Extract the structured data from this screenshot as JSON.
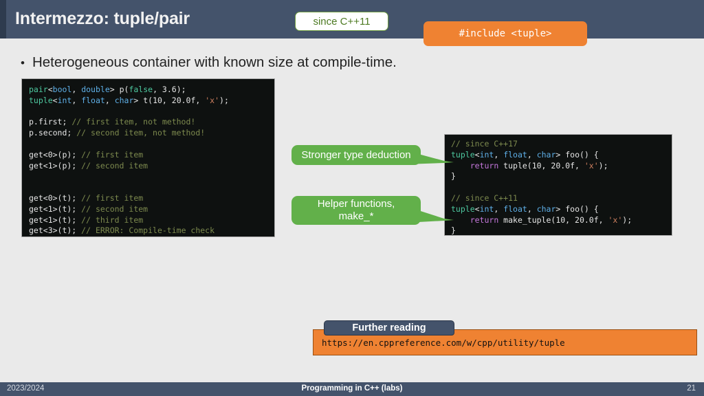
{
  "header": {
    "title": "Intermezzo: tuple/pair",
    "since_badge": "since C++11",
    "include_badge": "#include <tuple>"
  },
  "bullet": {
    "marker": "•",
    "text": "Heterogeneous container with known size at compile-time."
  },
  "code_left": {
    "lines": [
      [
        {
          "t": "pair",
          "c": "cls"
        },
        {
          "t": "<",
          "c": "plain"
        },
        {
          "t": "bool",
          "c": "type"
        },
        {
          "t": ", ",
          "c": "plain"
        },
        {
          "t": "double",
          "c": "type"
        },
        {
          "t": "> p(",
          "c": "plain"
        },
        {
          "t": "false",
          "c": "lit"
        },
        {
          "t": ", 3.6);",
          "c": "plain"
        }
      ],
      [
        {
          "t": "tuple",
          "c": "cls"
        },
        {
          "t": "<",
          "c": "plain"
        },
        {
          "t": "int",
          "c": "type"
        },
        {
          "t": ", ",
          "c": "plain"
        },
        {
          "t": "float",
          "c": "type"
        },
        {
          "t": ", ",
          "c": "plain"
        },
        {
          "t": "char",
          "c": "type"
        },
        {
          "t": "> t(10, 20.0f, ",
          "c": "plain"
        },
        {
          "t": "'x'",
          "c": "chr"
        },
        {
          "t": ");",
          "c": "plain"
        }
      ],
      [],
      [
        {
          "t": "p.first; ",
          "c": "plain"
        },
        {
          "t": "// first item, not method!",
          "c": "com"
        }
      ],
      [
        {
          "t": "p.second; ",
          "c": "plain"
        },
        {
          "t": "// second item, not method!",
          "c": "com"
        }
      ],
      [],
      [
        {
          "t": "get<0>(p); ",
          "c": "plain"
        },
        {
          "t": "// first item",
          "c": "com"
        }
      ],
      [
        {
          "t": "get<1>(p); ",
          "c": "plain"
        },
        {
          "t": "// second item",
          "c": "com"
        }
      ],
      [],
      [],
      [
        {
          "t": "get<0>(t); ",
          "c": "plain"
        },
        {
          "t": "// first item",
          "c": "com"
        }
      ],
      [
        {
          "t": "get<1>(t); ",
          "c": "plain"
        },
        {
          "t": "// second item",
          "c": "com"
        }
      ],
      [
        {
          "t": "get<1>(t); ",
          "c": "plain"
        },
        {
          "t": "// third item",
          "c": "com"
        }
      ],
      [
        {
          "t": "get<3>(t); ",
          "c": "plain"
        },
        {
          "t": "// ERROR: Compile-time check",
          "c": "com"
        }
      ]
    ]
  },
  "code_right": {
    "lines": [
      [
        {
          "t": "// since C++17",
          "c": "com"
        }
      ],
      [
        {
          "t": "tuple",
          "c": "cls"
        },
        {
          "t": "<",
          "c": "plain"
        },
        {
          "t": "int",
          "c": "type"
        },
        {
          "t": ", ",
          "c": "plain"
        },
        {
          "t": "float",
          "c": "type"
        },
        {
          "t": ", ",
          "c": "plain"
        },
        {
          "t": "char",
          "c": "type"
        },
        {
          "t": "> foo() {",
          "c": "plain"
        }
      ],
      [
        {
          "t": "    ",
          "c": "plain"
        },
        {
          "t": "return",
          "c": "kw"
        },
        {
          "t": " tuple(10, 20.0f, ",
          "c": "plain"
        },
        {
          "t": "'x'",
          "c": "chr"
        },
        {
          "t": ");",
          "c": "plain"
        }
      ],
      [
        {
          "t": "}",
          "c": "plain"
        }
      ],
      [],
      [
        {
          "t": "// since C++11",
          "c": "com"
        }
      ],
      [
        {
          "t": "tuple",
          "c": "cls"
        },
        {
          "t": "<",
          "c": "plain"
        },
        {
          "t": "int",
          "c": "type"
        },
        {
          "t": ", ",
          "c": "plain"
        },
        {
          "t": "float",
          "c": "type"
        },
        {
          "t": ", ",
          "c": "plain"
        },
        {
          "t": "char",
          "c": "type"
        },
        {
          "t": "> foo() {",
          "c": "plain"
        }
      ],
      [
        {
          "t": "    ",
          "c": "plain"
        },
        {
          "t": "return",
          "c": "kw"
        },
        {
          "t": " make_tuple(10, 20.0f, ",
          "c": "plain"
        },
        {
          "t": "'x'",
          "c": "chr"
        },
        {
          "t": ");",
          "c": "plain"
        }
      ],
      [
        {
          "t": "}",
          "c": "plain"
        }
      ]
    ]
  },
  "callouts": {
    "deduction": "Stronger type deduction",
    "helper_line1": "Helper functions,",
    "helper_line2": "make_*"
  },
  "further_reading": {
    "tab_label": "Further reading",
    "url": "https://en.cppreference.com/w/cpp/utility/tuple"
  },
  "footer": {
    "left": "2023/2024",
    "center": "Programming in C++ (labs)",
    "right": "21"
  },
  "colors": {
    "header_bg": "#44536b",
    "slide_bg": "#eaeaea",
    "orange": "#ef8232",
    "green_callout": "#62b04a",
    "badge_green_text": "#4d7a22",
    "code_bg": "#0e1110"
  }
}
